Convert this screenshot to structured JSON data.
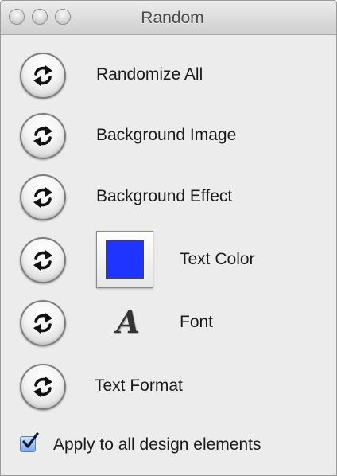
{
  "window": {
    "title": "Random"
  },
  "rows": {
    "randomize_all": {
      "label": "Randomize All",
      "icon": "shuffle-arrows-icon"
    },
    "background_image": {
      "label": "Background Image",
      "icon": "shuffle-arrows-icon"
    },
    "background_effect": {
      "label": "Background Effect",
      "icon": "shuffle-arrows-icon"
    },
    "text_color": {
      "label": "Text Color",
      "icon": "shuffle-arrows-icon",
      "color": "#1f35ff"
    },
    "font": {
      "label": "Font",
      "icon": "shuffle-arrows-icon",
      "glyph": "A"
    },
    "text_format": {
      "label": "Text Format",
      "icon": "shuffle-arrows-icon"
    }
  },
  "apply_all": {
    "label": "Apply to all design elements",
    "checked": true
  },
  "colors": {
    "accent": "#1f35ff",
    "checkbox": "#6f9be0"
  }
}
